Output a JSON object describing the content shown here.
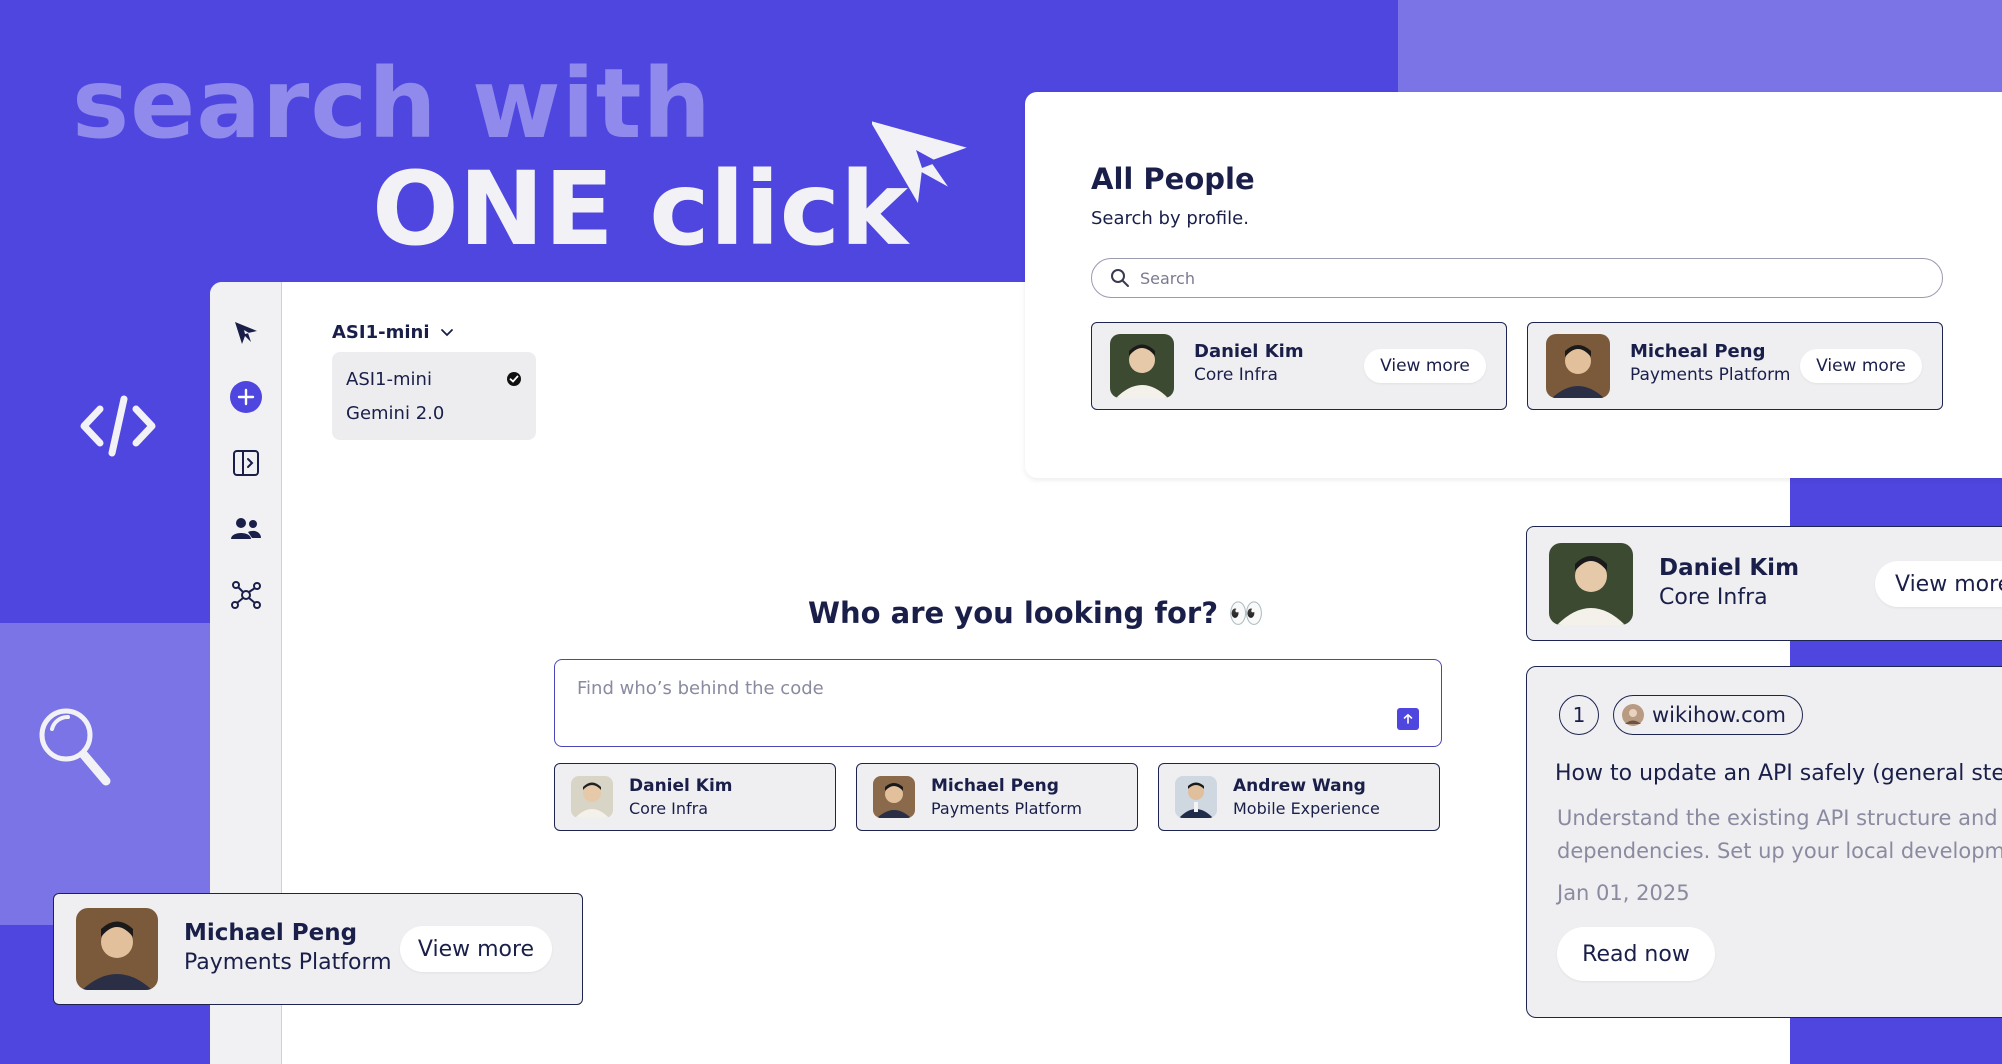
{
  "hero": {
    "line1": "search with",
    "line2": "ONE click"
  },
  "colors": {
    "brand_purple": "#4f46e0",
    "light_purple": "#7a74e6",
    "navy": "#1a1f4a",
    "card_bg": "#efeff1"
  },
  "sidebar": {
    "items": [
      {
        "icon": "cursor-logo-icon"
      },
      {
        "icon": "plus-circle-icon"
      },
      {
        "icon": "panel-toggle-icon"
      },
      {
        "icon": "people-icon"
      },
      {
        "icon": "network-graph-icon"
      }
    ]
  },
  "model_selector": {
    "selected": "ASI1-mini",
    "options": [
      {
        "label": "ASI1-mini",
        "checked": true
      },
      {
        "label": "Gemini 2.0",
        "checked": false
      }
    ]
  },
  "main": {
    "question": "Who are you looking for?",
    "question_emoji": "👀",
    "input_placeholder": "Find who’s behind the code",
    "suggestions": [
      {
        "name": "Daniel Kim",
        "team": "Core Infra"
      },
      {
        "name": "Michael Peng",
        "team": "Payments Platform"
      },
      {
        "name": "Andrew Wang",
        "team": "Mobile Experience"
      }
    ]
  },
  "people_panel": {
    "title": "All People",
    "subtitle": "Search by profile.",
    "search_placeholder": "Search",
    "cards": [
      {
        "name": "Daniel Kim",
        "team": "Core Infra",
        "button": "View more"
      },
      {
        "name": "Micheal Peng",
        "team": "Payments Platform",
        "button": "View more"
      }
    ]
  },
  "float_card_right": {
    "name": "Daniel Kim",
    "team": "Core Infra",
    "button": "View more"
  },
  "article_card": {
    "index": "1",
    "source": "wikihow.com",
    "title": "How to update an API safely (general steps",
    "body": "Understand the existing API structure and dependencies. Set up your local development",
    "date": "Jan 01, 2025",
    "button": "Read now"
  },
  "float_card_left": {
    "name": "Michael Peng",
    "team": "Payments Platform",
    "button": "View more"
  }
}
